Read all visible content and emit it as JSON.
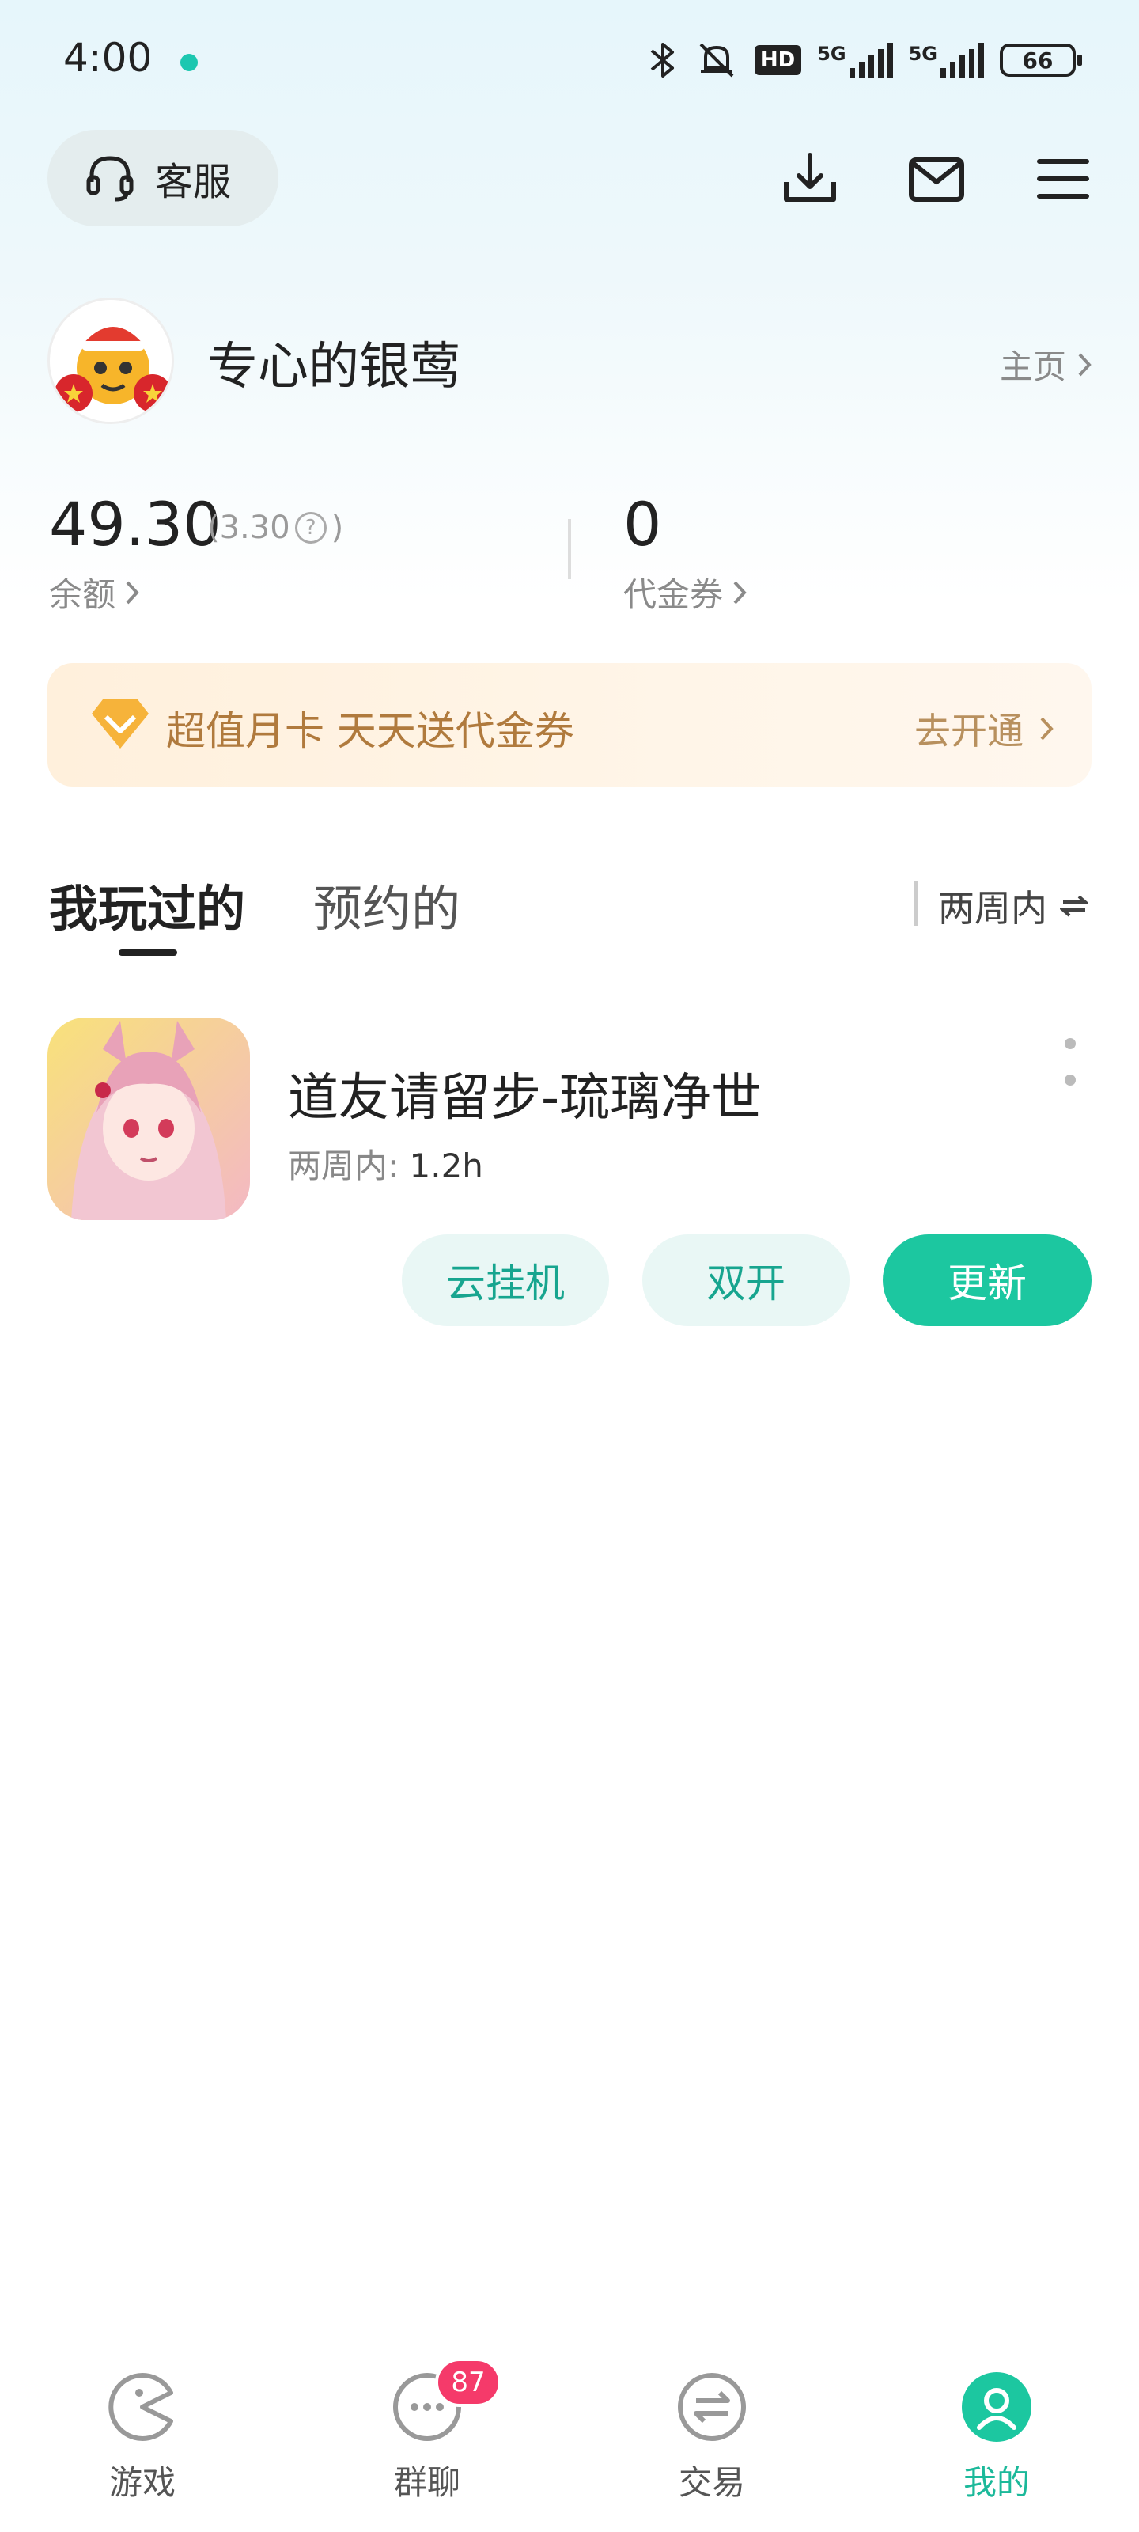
{
  "status_bar": {
    "time": "4:00",
    "hd_label": "HD",
    "signal1_label": "5G",
    "signal2_label": "5G",
    "battery": "66"
  },
  "header": {
    "service_label": "客服",
    "download_icon": "download-icon",
    "mail_icon": "mail-icon",
    "menu_icon": "menu-icon"
  },
  "profile": {
    "username": "专心的银莺",
    "home_link": "主页"
  },
  "wallet": {
    "balance": "49.30",
    "balance_sub_open": "(3.30",
    "balance_sub_close": ")",
    "balance_label": "余额",
    "voucher_count": "0",
    "voucher_label": "代金券"
  },
  "banner": {
    "text": "超值月卡 天天送代金券",
    "action": "去开通"
  },
  "tabs": {
    "played": "我玩过的",
    "reserved": "预约的",
    "period": "两周内"
  },
  "games": [
    {
      "title": "道友请留步-琉璃净世",
      "meta_label": "两周内: ",
      "meta_value": "1.2h",
      "btn_cloud": "云挂机",
      "btn_dual": "双开",
      "btn_update": "更新"
    }
  ],
  "bottom_nav": {
    "items": [
      {
        "label": "游戏",
        "icon": "pacman-icon"
      },
      {
        "label": "群聊",
        "icon": "chat-icon",
        "badge": "87"
      },
      {
        "label": "交易",
        "icon": "exchange-icon"
      },
      {
        "label": "我的",
        "icon": "profile-icon",
        "active": true
      }
    ]
  },
  "colors": {
    "accent": "#1cc7a0",
    "banner_text": "#b07a3d",
    "badge": "#f53a6a"
  }
}
